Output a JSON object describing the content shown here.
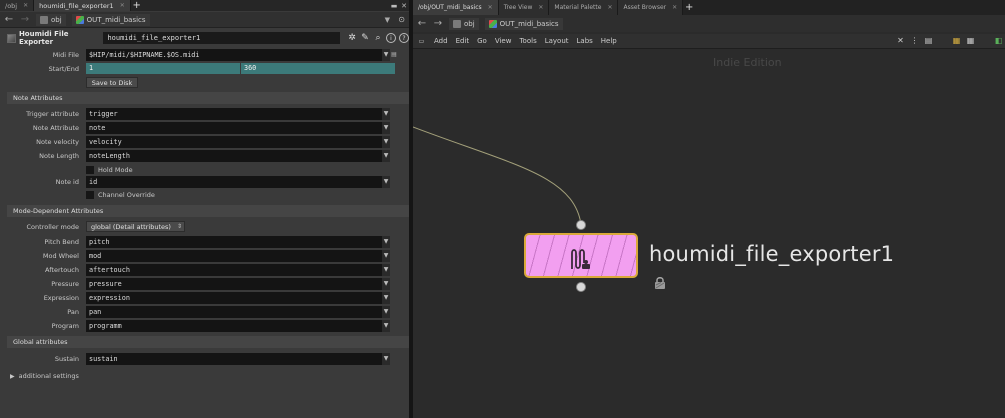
{
  "left": {
    "tabs": [
      {
        "label": "/obj",
        "active": false
      },
      {
        "label": "houmidi_file_exporter1",
        "active": true
      }
    ],
    "path": {
      "root": "obj",
      "node": "OUT_midi_basics"
    },
    "node": {
      "type_label": "Houmidi File Exporter",
      "name": "houmidi_file_exporter1"
    },
    "params": {
      "midi_file": {
        "label": "Midi File",
        "value": "$HIP/midi/$HIPNAME.$OS.midi"
      },
      "start_end": {
        "label": "Start/End",
        "start": "1",
        "end": "360"
      },
      "save_button": "Save to Disk"
    },
    "sections": {
      "note": "Note Attributes",
      "mode": "Mode-Dependent Attributes",
      "global": "Global attributes"
    },
    "note_attrs": [
      {
        "label": "Trigger attribute",
        "value": "trigger"
      },
      {
        "label": "Note Attribute",
        "value": "note"
      },
      {
        "label": "Note velocity",
        "value": "velocity"
      },
      {
        "label": "Note Length",
        "value": "noteLength"
      }
    ],
    "hold_mode": "Hold Mode",
    "note_id": {
      "label": "Note id",
      "value": "id"
    },
    "channel_override": "Channel Override",
    "controller_mode": {
      "label": "Controller mode",
      "value": "global (Detail attributes)"
    },
    "mode_attrs": [
      {
        "label": "Pitch Bend",
        "value": "pitch"
      },
      {
        "label": "Mod Wheel",
        "value": "mod"
      },
      {
        "label": "Aftertouch",
        "value": "aftertouch"
      },
      {
        "label": "Pressure",
        "value": "pressure"
      },
      {
        "label": "Expression",
        "value": "expression"
      },
      {
        "label": "Pan",
        "value": "pan"
      },
      {
        "label": "Program",
        "value": "programm"
      }
    ],
    "sustain": {
      "label": "Sustain",
      "value": "sustain"
    },
    "additional": "additional settings"
  },
  "right": {
    "tabs": [
      {
        "label": "/obj/OUT_midi_basics",
        "active": true
      },
      {
        "label": "Tree View",
        "active": false
      },
      {
        "label": "Material Palette",
        "active": false
      },
      {
        "label": "Asset Browser",
        "active": false
      }
    ],
    "path": {
      "root": "obj",
      "node": "OUT_midi_basics"
    },
    "menu": [
      "Add",
      "Edit",
      "Go",
      "View",
      "Tools",
      "Layout",
      "Labs",
      "Help"
    ],
    "watermark": "Indie Edition",
    "node_name": "houmidi_file_exporter1",
    "node_color": "#f29ff0",
    "node_border_color": "#d9a93a"
  }
}
